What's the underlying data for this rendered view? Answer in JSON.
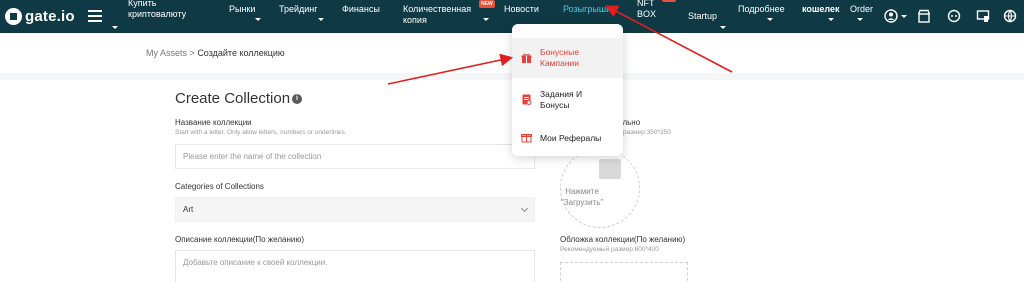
{
  "nav": {
    "logo": "gate.io",
    "items": [
      {
        "label": "Купить\nкриптовалюту"
      },
      {
        "label": "Рынки"
      },
      {
        "label": "Трейдинг"
      },
      {
        "label": "Финансы"
      },
      {
        "label": "Количественная\nкопия",
        "badge": "NEW"
      },
      {
        "label": "Новости"
      },
      {
        "label": "Розыгрыши"
      },
      {
        "label": "NFT\nBOX"
      },
      {
        "label": "Startup"
      },
      {
        "label": "Подробнее"
      },
      {
        "label": "кошелек"
      },
      {
        "label": "Order"
      }
    ]
  },
  "breadcrumb": {
    "parent": "My Assets",
    "separator": ">",
    "current": "Создайте коллекцию"
  },
  "form": {
    "title": "Create Collection",
    "info": "i",
    "name_label": "Название коллекции",
    "name_hint": "Start with a letter. Only allow letters, numbers or underlines.",
    "name_placeholder": "Please enter the name of the collection",
    "category_label": "Categories of Collections",
    "category_value": "Art",
    "desc_label": "Описание коллекции(По желанию)",
    "desc_placeholder": "Добавьте описание к своей коллекции.",
    "logo_label_partial": "ально",
    "logo_hint_partial": "размер:350*350",
    "upload_text": "Нажмите \"Загрузить\"",
    "cover_label": "Обложка коллекции(По желанию)",
    "cover_hint": "Рекомендуемый размер:600*400"
  },
  "dropdown": {
    "items": [
      {
        "label": "Бонусные\nКампании"
      },
      {
        "label": "Задания И\nБонусы"
      },
      {
        "label": "Мои Рефералы"
      }
    ]
  },
  "colors": {
    "nav_bg": "#0f3a45",
    "accent_active": "#4fc9e6",
    "highlight_red": "#e8403a",
    "arrow": "#e02020"
  }
}
